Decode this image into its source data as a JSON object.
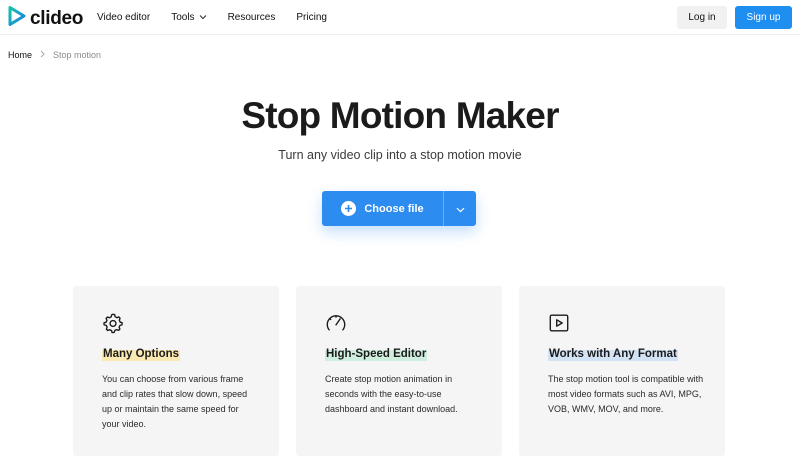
{
  "header": {
    "logo_text": "clideo",
    "nav": [
      {
        "label": "Video editor"
      },
      {
        "label": "Tools"
      },
      {
        "label": "Resources"
      },
      {
        "label": "Pricing"
      }
    ],
    "login_label": "Log in",
    "signup_label": "Sign up"
  },
  "breadcrumb": {
    "home": "Home",
    "current": "Stop motion"
  },
  "hero": {
    "title": "Stop Motion Maker",
    "subtitle": "Turn any video clip into a stop motion movie",
    "choose_file_label": "Choose file"
  },
  "features": [
    {
      "icon": "gear-icon",
      "title": "Many Options",
      "description": "You can choose from various frame and clip rates that slow down, speed up or maintain the same speed for your video."
    },
    {
      "icon": "speedometer-icon",
      "title": "High-Speed Editor",
      "description": "Create stop motion animation in seconds with the easy-to-use dashboard and instant download."
    },
    {
      "icon": "video-play-icon",
      "title": "Works with Any Format",
      "description": "The stop motion tool is compatible with most video formats such as AVI, MPG, VOB, WMV, MOV, and more."
    }
  ],
  "colors": {
    "brand_blue": "#1f8ef1",
    "logo_teal": "#18b6c4",
    "highlight_yellow": "#fbe9b3",
    "highlight_green": "#cfeedd",
    "highlight_blue": "#d3e3f6"
  }
}
